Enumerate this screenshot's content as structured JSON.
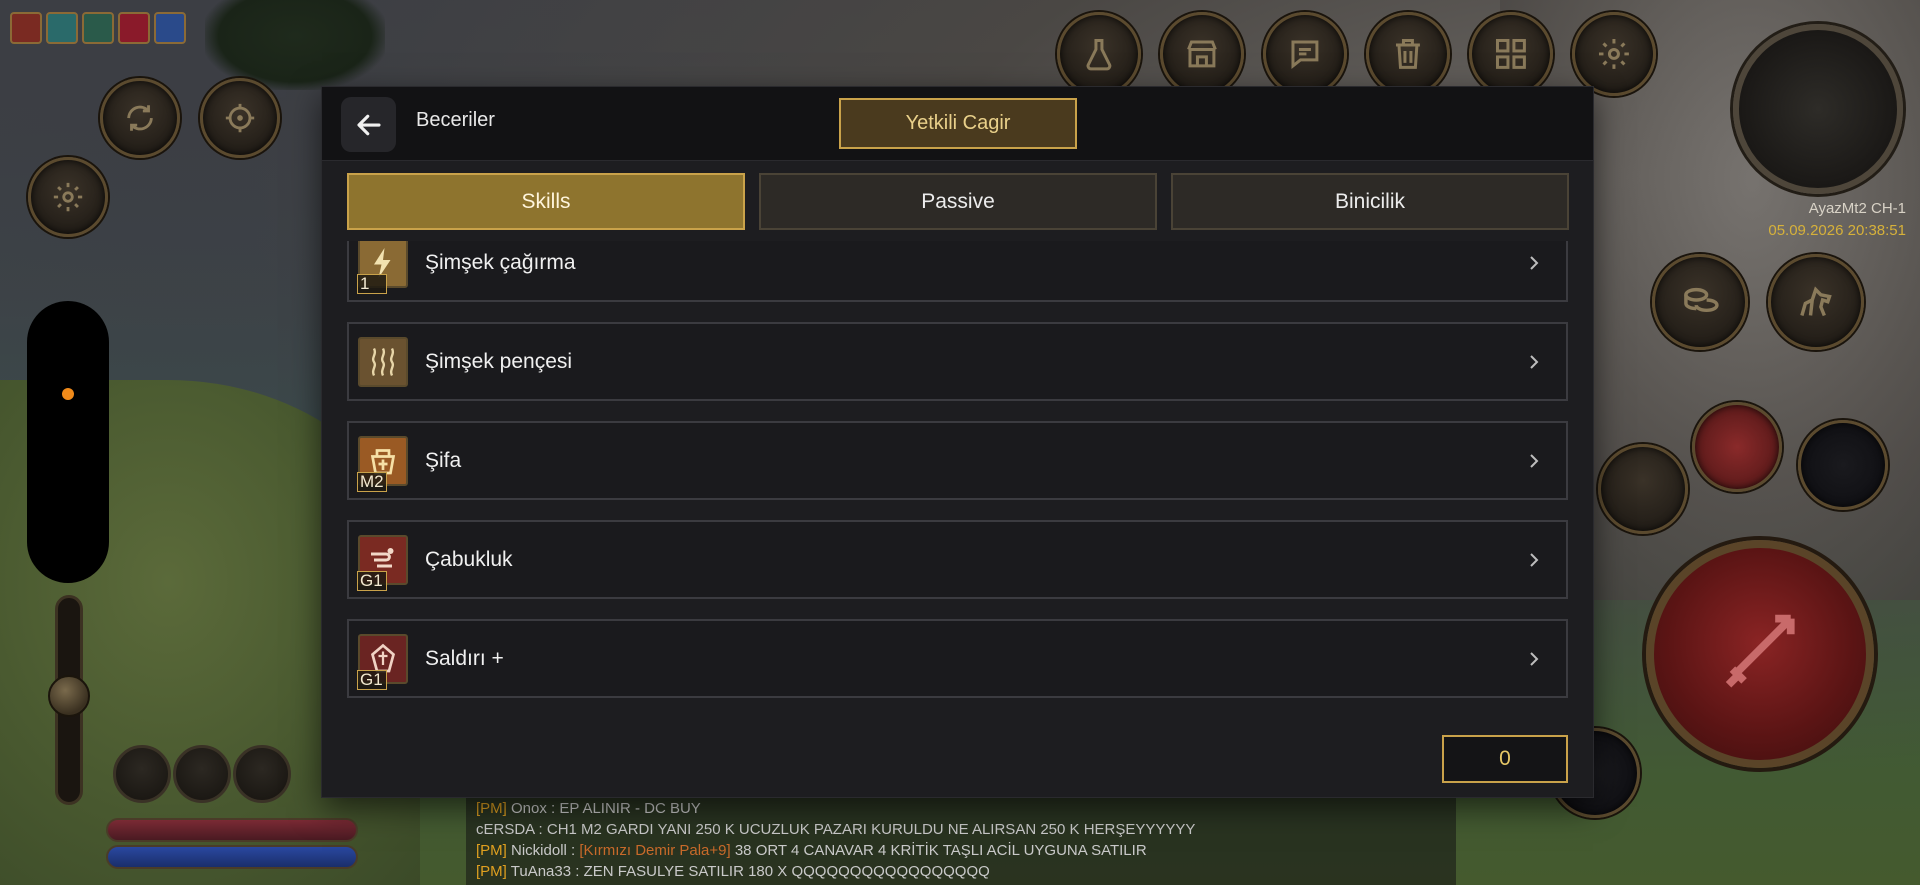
{
  "dialog": {
    "title": "Beceriler",
    "call_button": "Yetkili Cagir",
    "tabs": [
      {
        "label": "Skills",
        "active": true
      },
      {
        "label": "Passive",
        "active": false
      },
      {
        "label": "Binicilik",
        "active": false
      }
    ],
    "skills": [
      {
        "name": "Şimşek çağırma",
        "level": "1",
        "icon": "lightning-summon-icon",
        "icon_bg": "#8a6a34"
      },
      {
        "name": "Şimşek pençesi",
        "level": "",
        "icon": "lightning-claw-icon",
        "icon_bg": "#6a5230"
      },
      {
        "name": "Şifa",
        "level": "M2",
        "icon": "heal-icon",
        "icon_bg": "#9a5a24"
      },
      {
        "name": "Çabukluk",
        "level": "G1",
        "icon": "swiftness-icon",
        "icon_bg": "#7a2a22"
      },
      {
        "name": "Saldırı +",
        "level": "G1",
        "icon": "attack-up-icon",
        "icon_bg": "#6a2422"
      }
    ],
    "skill_points": "0"
  },
  "hud": {
    "server_name": "AyazMt2 CH-1",
    "datetime": "05.09.2026 20:38:51",
    "top_buttons": [
      "potion-icon",
      "shop-icon",
      "chat-icon",
      "trash-icon",
      "grid-icon",
      "gear-icon"
    ]
  },
  "chat": [
    {
      "tag": "[PM]",
      "sender": "Onox :",
      "item": "",
      "text": "EP ALINIR - DC BUY"
    },
    {
      "tag": "",
      "sender": "cERSDA :",
      "item": "",
      "text": "CH1 M2 GARDI YANI 250 K UCUZLUK PAZARI KURULDU NE ALIRSAN 250 K HERŞEYYYYYY"
    },
    {
      "tag": "[PM]",
      "sender": "Nickidoll :",
      "item": "[Kırmızı Demir Pala+9]",
      "text": "38 ORT 4 CANAVAR 4 KRİTİK TAŞLI ACİL UYGUNA SATILIR"
    },
    {
      "tag": "[PM]",
      "sender": "TuAna33 :",
      "item": "",
      "text": "ZEN FASULYE SATILIR 180 X QQQQQQQQQQQQQQQQQ"
    }
  ],
  "colors": {
    "accent_gold": "#c9a24a",
    "tab_active": "#8e742e",
    "dialog_bg": "#1d1d20"
  }
}
